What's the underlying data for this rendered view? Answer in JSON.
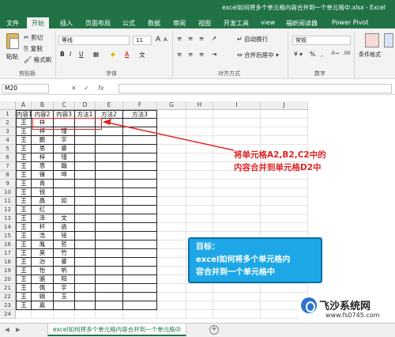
{
  "window": {
    "title": "excel如何将多个单元格内容合并到一个单元格中.xlsx - Excel"
  },
  "ribbon_tabs": [
    "文件",
    "开始",
    "插入",
    "页面布局",
    "公式",
    "数据",
    "审阅",
    "视图",
    "开发工具",
    "view",
    "福昕阅读器",
    "Power Pivot"
  ],
  "ribbon": {
    "paste": "粘贴",
    "cut": "剪切",
    "copy": "复制",
    "format_painter": "格式刷",
    "clipboard_group": "剪贴板",
    "font_name": "等线",
    "font_size": "11",
    "font_group": "字体",
    "wrap_text": "自动换行",
    "merge_center": "合并后居中",
    "align_group": "对齐方式",
    "number_format": "常规",
    "percent": "%",
    "comma": ",",
    "number_group": "数字",
    "cond_format": "条件格式",
    "bold": "B",
    "italic": "I",
    "underline": "U",
    "font_color": "A",
    "grow": "A",
    "shrink": "A"
  },
  "formula_bar": {
    "name_box": "M20",
    "fx": "fx",
    "value": ""
  },
  "columns": [
    "A",
    "B",
    "C",
    "D",
    "E",
    "F",
    "G",
    "H",
    "I",
    "J"
  ],
  "rows": [
    [
      "1",
      "内容1",
      "内容2",
      "内容3",
      "方法1",
      "方法2",
      "方法3"
    ],
    [
      "2",
      "王",
      "祥",
      "",
      "",
      "",
      ""
    ],
    [
      "3",
      "王",
      "梓",
      "瑾",
      "",
      "",
      ""
    ],
    [
      "4",
      "王",
      "鹏",
      "宇",
      "",
      "",
      ""
    ],
    [
      "5",
      "王",
      "思",
      "睿",
      "",
      "",
      ""
    ],
    [
      "6",
      "王",
      "梓",
      "瑾",
      "",
      "",
      ""
    ],
    [
      "7",
      "王",
      "思",
      "翰",
      "",
      "",
      ""
    ],
    [
      "8",
      "王",
      "锋",
      "坤",
      "",
      "",
      ""
    ],
    [
      "9",
      "王",
      "青",
      "",
      "",
      "",
      ""
    ],
    [
      "10",
      "王",
      "锐",
      "",
      "",
      "",
      ""
    ],
    [
      "11",
      "王",
      "晶",
      "如",
      "",
      "",
      ""
    ],
    [
      "12",
      "王",
      "红",
      "",
      "",
      "",
      ""
    ],
    [
      "13",
      "王",
      "泽",
      "文",
      "",
      "",
      ""
    ],
    [
      "14",
      "王",
      "杆",
      "函",
      "",
      "",
      ""
    ],
    [
      "15",
      "王",
      "浩",
      "铭",
      "",
      "",
      ""
    ],
    [
      "16",
      "王",
      "胤",
      "哲",
      "",
      "",
      ""
    ],
    [
      "17",
      "王",
      "昊",
      "竹",
      "",
      "",
      ""
    ],
    [
      "18",
      "王",
      "治",
      "睿",
      "",
      "",
      ""
    ],
    [
      "19",
      "王",
      "怡",
      "帆",
      "",
      "",
      ""
    ],
    [
      "20",
      "王",
      "骆",
      "阳",
      "",
      "",
      ""
    ],
    [
      "21",
      "王",
      "佩",
      "宇",
      "",
      "",
      ""
    ],
    [
      "22",
      "王",
      "婉",
      "玉",
      "",
      "",
      ""
    ],
    [
      "23",
      "王",
      "嘉",
      "",
      "",
      "",
      ""
    ],
    [
      "24",
      "",
      "",
      "",
      "",
      "",
      ""
    ]
  ],
  "annotation": {
    "line1": "将单元格A2,B2,C2中的",
    "line2": "内容合并到单元格D2中"
  },
  "goal": {
    "title": "目标：",
    "line1": "excel如何将多个单元格内",
    "line2": "容合并到一个单元格中"
  },
  "sheet_tab": "excel如何将多个单元格内容合并到一个单元格中",
  "add_sheet": "+",
  "watermark": {
    "title": "飞沙系统网",
    "url": "www.fs0745.com"
  },
  "colors": {
    "excel_green": "#217346",
    "red": "#e02424",
    "goal_blue": "#1da7e6"
  }
}
